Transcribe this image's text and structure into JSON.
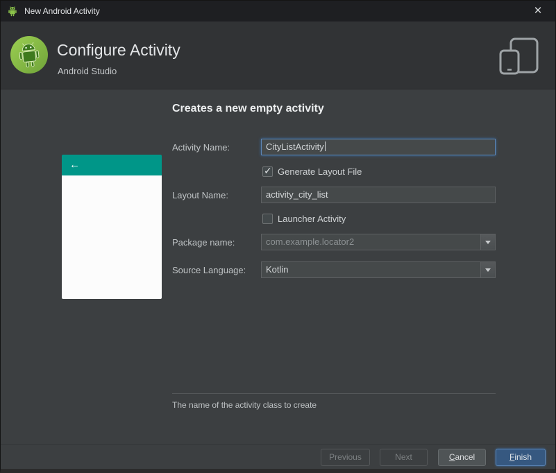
{
  "window": {
    "title": "New Android Activity",
    "close_glyph": "✕"
  },
  "header": {
    "title": "Configure Activity",
    "subtitle": "Android Studio"
  },
  "main": {
    "heading": "Creates a new empty activity",
    "preview": {
      "back_arrow": "←"
    },
    "fields": {
      "activity_name": {
        "label": "Activity Name:",
        "value": "CityListActivity"
      },
      "generate_layout": {
        "label": "Generate Layout File",
        "checked": true
      },
      "layout_name": {
        "label": "Layout Name:",
        "value": "activity_city_list"
      },
      "launcher": {
        "label": "Launcher Activity",
        "checked": false
      },
      "package": {
        "label": "Package name:",
        "value": "com.example.locator2"
      },
      "source_language": {
        "label": "Source Language:",
        "value": "Kotlin"
      }
    },
    "hint": "The name of the activity class to create"
  },
  "footer": {
    "previous": "Previous",
    "next": "Next",
    "cancel": {
      "mnemonic": "C",
      "rest": "ancel"
    },
    "finish": {
      "mnemonic": "F",
      "rest": "inish"
    }
  },
  "colors": {
    "preview_header_teal": "#009688",
    "primary_button_blue": "#365880",
    "focus_border_blue": "#5d87b8",
    "content_background": "#3c3f41",
    "header_background": "#313335",
    "titlebar_background": "#1e1f22"
  }
}
